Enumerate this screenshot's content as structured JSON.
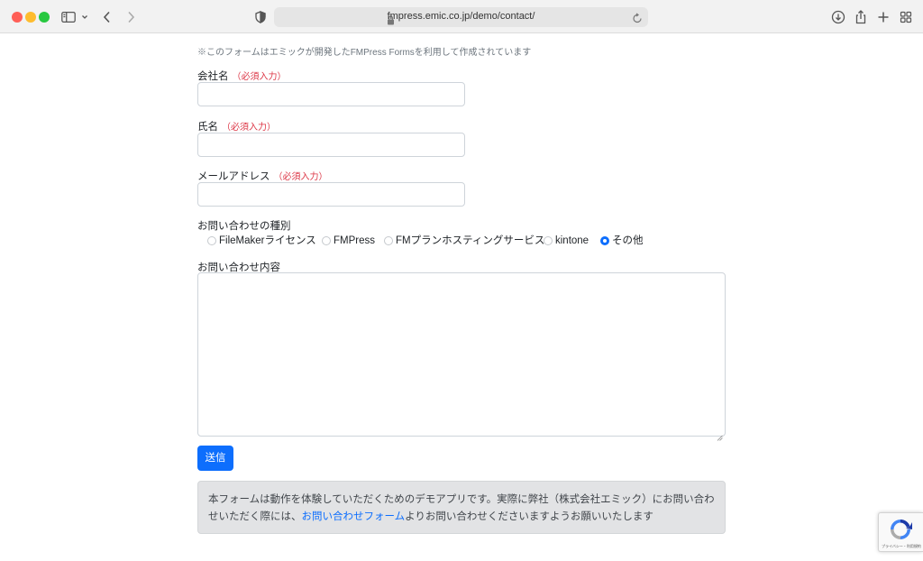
{
  "browser": {
    "url": "fmpress.emic.co.jp/demo/contact/",
    "icons": [
      "sidebar-icon",
      "chevron-down-icon",
      "back-arrow-icon",
      "forward-arrow-icon",
      "shield-icon",
      "lock-icon",
      "reload-icon",
      "download-icon",
      "share-icon",
      "new-tab-icon",
      "tab-overview-icon"
    ]
  },
  "form": {
    "notice": "※このフォームはエミックが開発したFMPress Formsを利用して作成されています",
    "required_mark": "（必須入力）",
    "company_label": "会社名",
    "name_label": "氏名",
    "email_label": "メールアドレス",
    "inquiry_type_label": "お問い合わせの種別",
    "inquiry_options": [
      {
        "label": "FileMakerライセンス",
        "checked": false
      },
      {
        "label": "FMPress",
        "checked": false
      },
      {
        "label": "FMプランホスティングサービス",
        "checked": false
      },
      {
        "label": "kintone",
        "checked": false
      },
      {
        "label": "その他",
        "checked": true
      }
    ],
    "content_label": "お問い合わせ内容",
    "submit_label": "送信"
  },
  "info": {
    "text_before": "本フォームは動作を体験していただくためのデモアプリです。実際に弊社（株式会社エミック）にお問い合わせいただく際には、",
    "link_text": "お問い合わせフォーム",
    "text_after": "よりお問い合わせくださいますようお願いいたします"
  },
  "recaptcha": {
    "text": "プライバシー・利用規約"
  },
  "colors": {
    "primary": "#0d6efd",
    "required": "#dc3545"
  }
}
